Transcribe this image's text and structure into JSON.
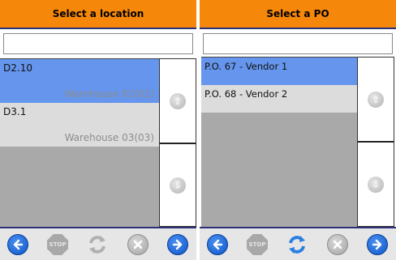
{
  "left_panel": {
    "title": "Select a location",
    "search": {
      "value": "",
      "placeholder": ""
    },
    "items": [
      {
        "code": "D2.10",
        "warehouse": "Warehouse 02(02)",
        "selected": true
      },
      {
        "code": "D3.1",
        "warehouse": "Warehouse 03(03)",
        "selected": false
      }
    ]
  },
  "right_panel": {
    "title": "Select a PO",
    "search": {
      "value": "",
      "placeholder": ""
    },
    "items": [
      {
        "label": "P.O. 67 - Vendor 1",
        "selected": true
      },
      {
        "label": "P.O. 68 - Vendor 2",
        "selected": false
      }
    ]
  },
  "toolbar": {
    "stop_label": "STOP"
  },
  "colors": {
    "header": "#f5870a",
    "selected_row": "#6595ec",
    "unselected_row": "#dcdcdc",
    "list_background": "#a9a9a9",
    "accent_line": "#2c2f7a",
    "nav_blue": "#0d56c9"
  }
}
